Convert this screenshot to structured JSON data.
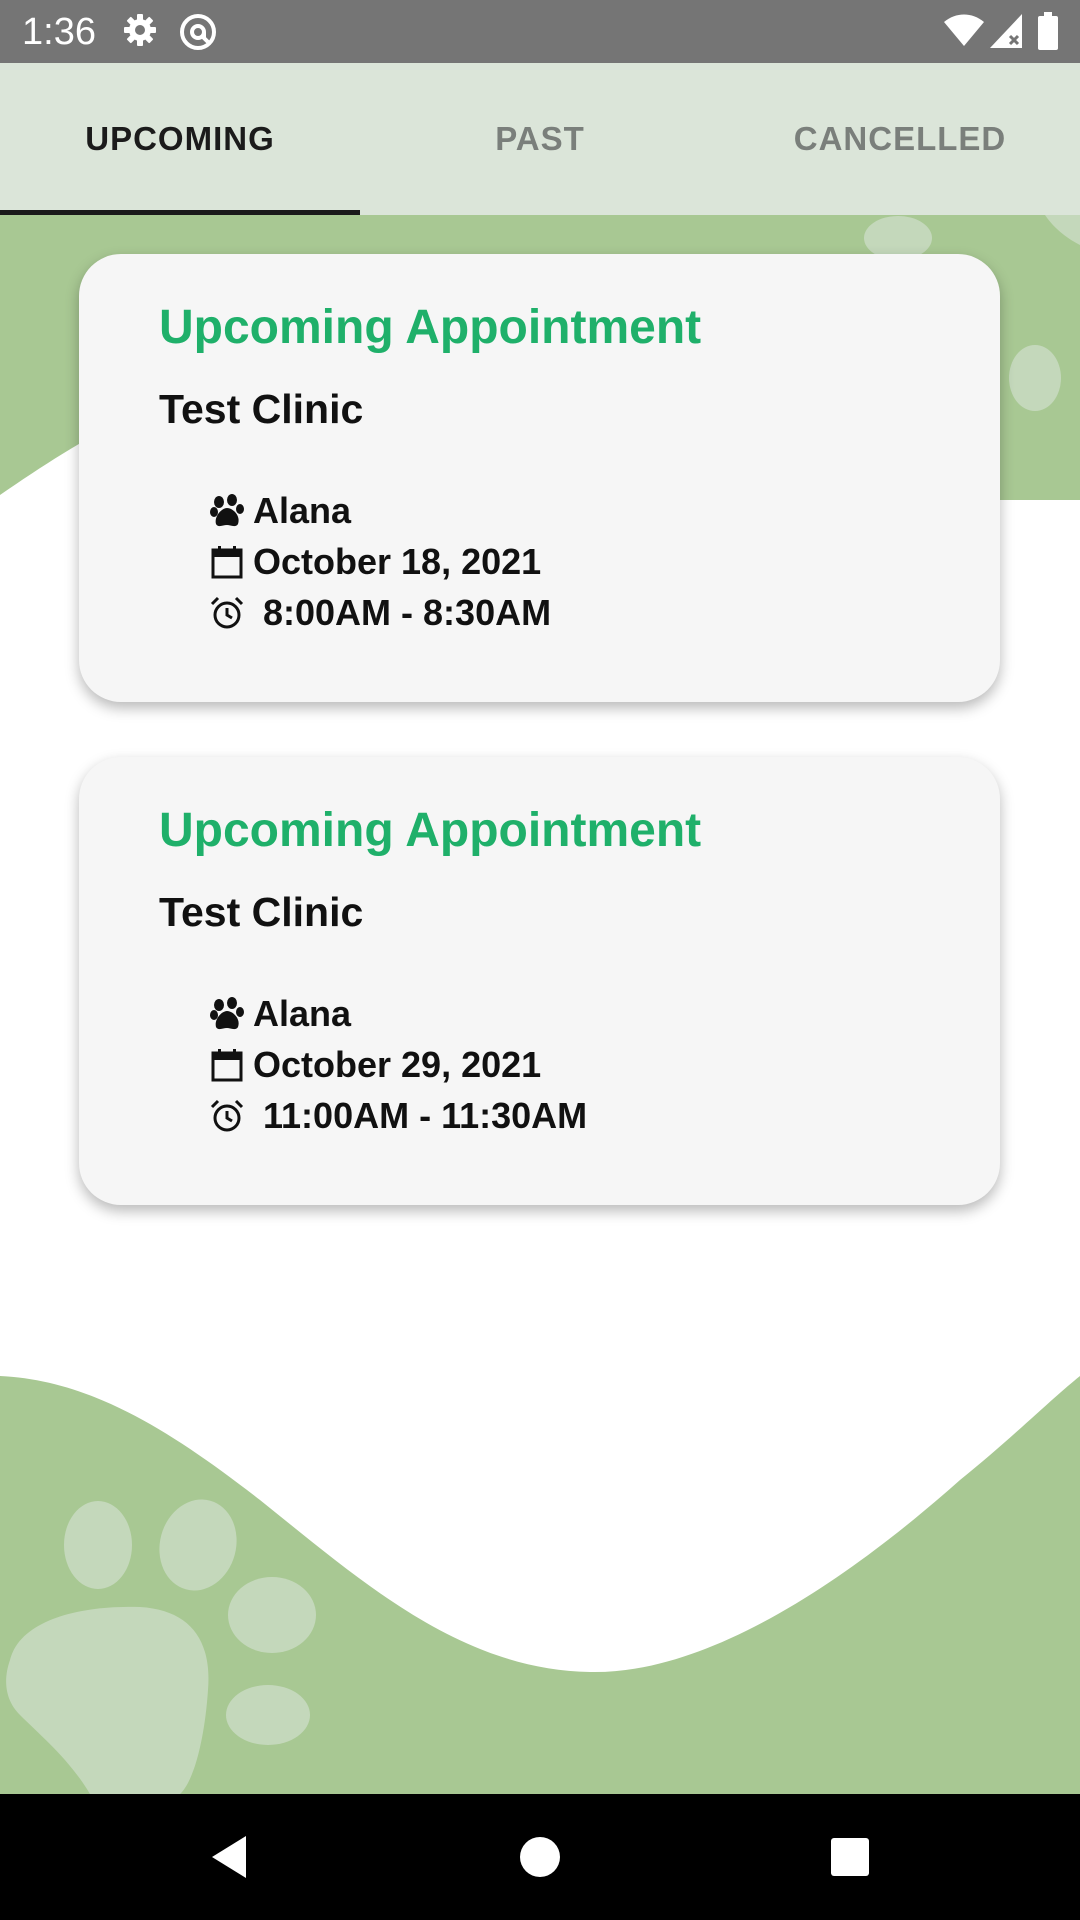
{
  "status_bar": {
    "time": "1:36",
    "icons": [
      "gear-icon",
      "at-sign-icon",
      "wifi-icon",
      "signal-icon",
      "battery-icon"
    ]
  },
  "tabs": [
    {
      "label": "UPCOMING",
      "active": true
    },
    {
      "label": "PAST",
      "active": false
    },
    {
      "label": "CANCELLED",
      "active": false
    }
  ],
  "appointments": [
    {
      "title": "Upcoming Appointment",
      "clinic": "Test Clinic",
      "pet": "Alana",
      "date": "October 18, 2021",
      "time": " 8:00AM - 8:30AM"
    },
    {
      "title": "Upcoming Appointment",
      "clinic": "Test Clinic",
      "pet": "Alana",
      "date": "October 29, 2021",
      "time": " 11:00AM - 11:30AM"
    }
  ],
  "colors": {
    "accent_green": "#1fb06a",
    "background_green": "#a8c893",
    "paw_light": "#c4d8bb",
    "tab_bar": "#dbe5d9"
  },
  "nav_bar": {
    "buttons": [
      "back-icon",
      "home-icon",
      "recents-icon"
    ]
  }
}
